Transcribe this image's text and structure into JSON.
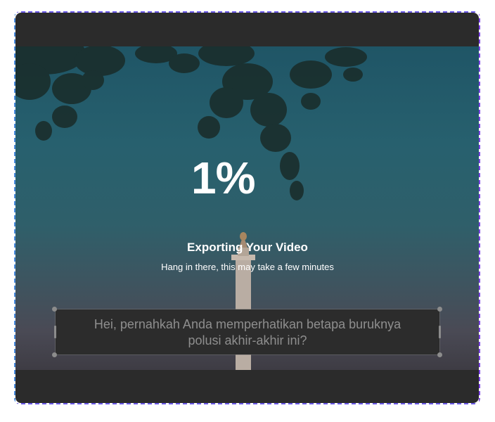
{
  "export": {
    "percent": "1%",
    "progress": 0.01,
    "title": "Exporting Your Video",
    "subtitle": "Hang in there, this may take a few minutes"
  },
  "caption": {
    "text_line1": "Hei, pernahkah Anda memperhatikan betapa buruknya",
    "text_line2": "polusi akhir-akhir ini?"
  },
  "colors": {
    "frame_border": "#6c5be8",
    "player_bg": "#2b2b2b",
    "sky_top": "#1f5566",
    "sky_bottom": "#3e3c44",
    "caption_text": "#8e8e8e"
  }
}
